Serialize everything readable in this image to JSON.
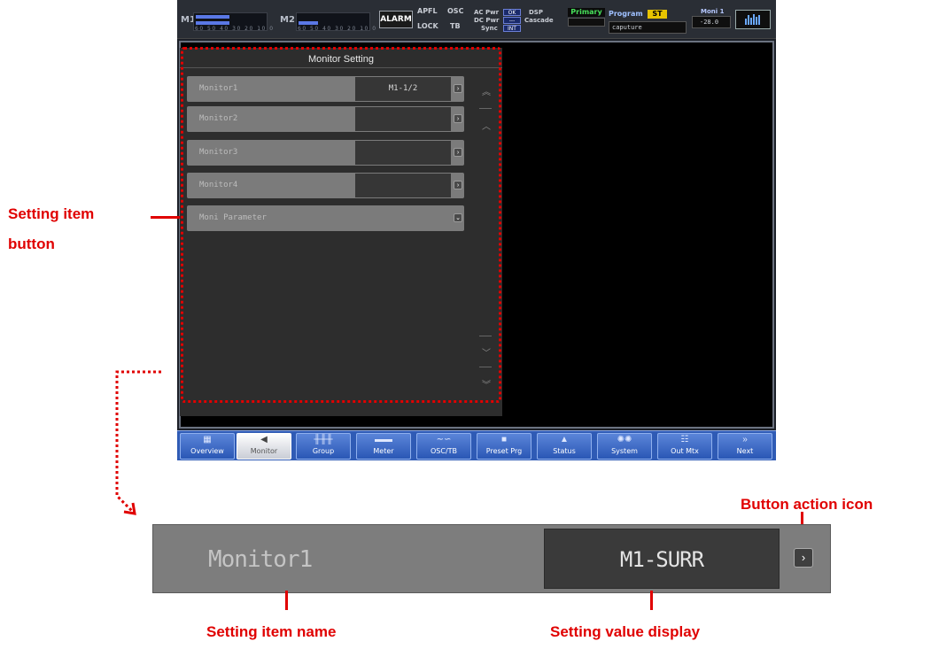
{
  "topbar": {
    "m1_label": "M1",
    "m2_label": "M2",
    "scale_text": "60 50 40 30 20 10 0",
    "m1_fill_fraction": 0.48,
    "m2_fill_fraction": 0.28,
    "alarm_label": "ALARM",
    "apfl_label": "APFL",
    "osc_label": "OSC",
    "lock_label": "LOCK",
    "tb_label": "TB",
    "ac_pwr_label": "AC Pwr",
    "dc_pwr_label": "DC Pwr",
    "sync_label": "Sync",
    "ac_pwr_value": "OK",
    "dc_pwr_value": "---",
    "sync_value": "INT",
    "dsp_label": "DSP",
    "cascade_label": "Cascade",
    "primary_label": "Primary",
    "program_label": "Program",
    "program_mode": "ST",
    "program_name": "caputure",
    "moni_label": "Moni 1",
    "moni_value": "-28.0",
    "meter_icon": "meter-bars-icon"
  },
  "panel": {
    "title": "Monitor Setting",
    "rows": [
      {
        "name": "Monitor1",
        "value": "M1-1/2"
      },
      {
        "name": "Monitor2",
        "value": ""
      },
      {
        "name": "Monitor3",
        "value": ""
      },
      {
        "name": "Monitor4",
        "value": ""
      }
    ],
    "param_row": {
      "name": "Moni Parameter"
    }
  },
  "nav": {
    "items": [
      {
        "label": "Overview",
        "icon": "overview-icon"
      },
      {
        "label": "Monitor",
        "icon": "speaker-icon"
      },
      {
        "label": "Group",
        "icon": "faders-icon"
      },
      {
        "label": "Meter",
        "icon": "meter-icon"
      },
      {
        "label": "OSC/TB",
        "icon": "wave-icon"
      },
      {
        "label": "Preset Prg",
        "icon": "preset-icon"
      },
      {
        "label": "Status",
        "icon": "warning-icon"
      },
      {
        "label": "System",
        "icon": "gears-icon"
      },
      {
        "label": "Out Mtx",
        "icon": "matrix-icon"
      },
      {
        "label": "Next",
        "icon": "double-chevron-right-icon"
      }
    ],
    "active": "Monitor"
  },
  "annotations": {
    "setting_item_button_line1": "Setting item",
    "setting_item_button_line2": "button",
    "button_action_icon": "Button action icon",
    "setting_item_name": "Setting item name",
    "setting_value_display": "Setting value display"
  },
  "zoom": {
    "name": "Monitor1",
    "value": "M1-SURR"
  },
  "colors": {
    "annotation_red": "#e00000",
    "nav_blue": "#2f5bb5",
    "meter_blue": "#5a78e6"
  }
}
